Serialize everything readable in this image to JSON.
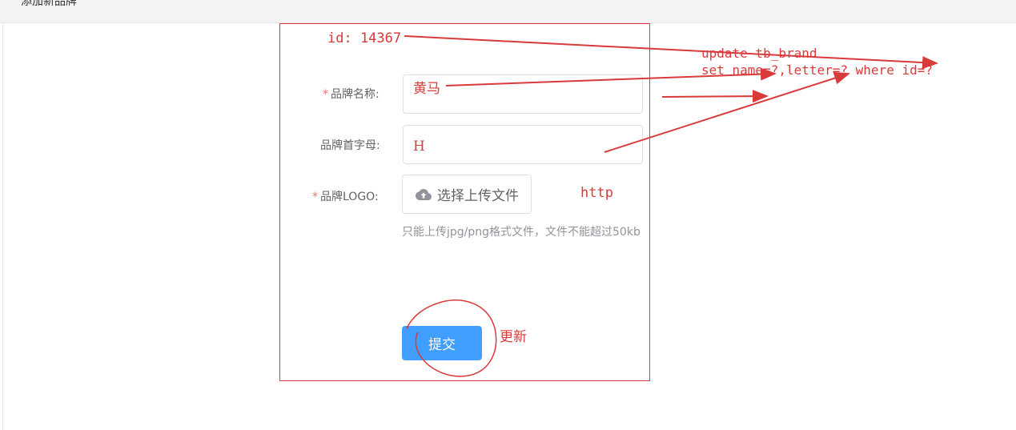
{
  "page": {
    "title": "添加新品牌"
  },
  "form": {
    "name_label": "品牌名称:",
    "name_value": "黄马",
    "letter_label": "品牌首字母:",
    "letter_value": "H",
    "logo_label": "品牌LOGO:",
    "upload_button": "选择上传文件",
    "upload_hint": "只能上传jpg/png格式文件，文件不能超过50kb",
    "submit_button": "提交",
    "required_mark": "*"
  },
  "annotations": {
    "id_text": "id: 14367",
    "sql_line1": "update tb_brand",
    "sql_line2": "set name=?,letter=? where id=?",
    "http_text": "http",
    "update_text": "更新"
  },
  "colors": {
    "annotation_red": "#d93a3a",
    "primary_blue": "#409eff",
    "required_star": "#f56c6c"
  },
  "icons": {
    "upload": "cloud-upload-icon"
  }
}
